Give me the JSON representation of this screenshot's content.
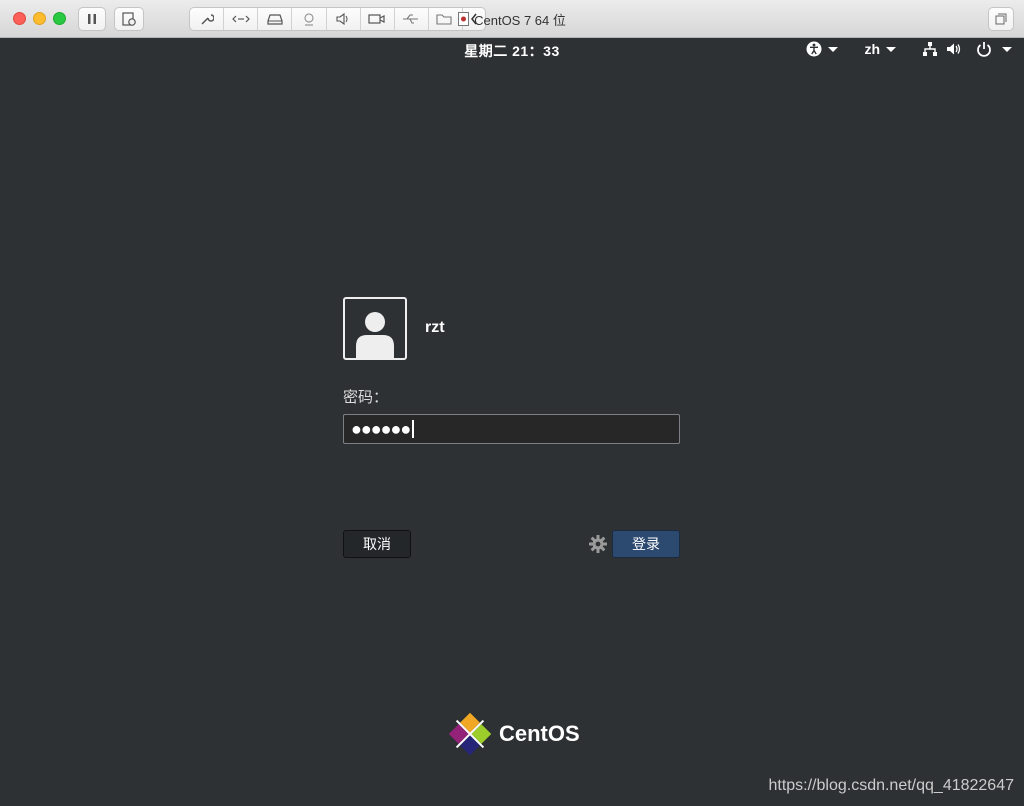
{
  "window": {
    "title": "CentOS 7 64 位",
    "toolbar_icons": [
      "pause-icon",
      "snapshot-icon",
      "wrench-icon",
      "network-icon",
      "disk-icon",
      "camera-icon",
      "sound-icon",
      "video-icon",
      "usb-icon",
      "shared-folder-icon",
      "collapse-chevron-icon",
      "fullscreen-icon"
    ]
  },
  "topbar": {
    "clock": "星期二  21：33",
    "language": "zh",
    "icons": [
      "accessibility-icon",
      "network-wired-icon",
      "volume-icon",
      "power-icon"
    ]
  },
  "login": {
    "username": "rzt",
    "password_label": "密码：",
    "password_mask": "●●●●●●",
    "cancel_label": "取消",
    "login_label": "登录"
  },
  "branding": {
    "logo_text": "CentOS"
  },
  "watermark": "https://blog.csdn.net/qq_41822647",
  "colors": {
    "background": "#2d3133",
    "login_button": "#2c4a70"
  }
}
